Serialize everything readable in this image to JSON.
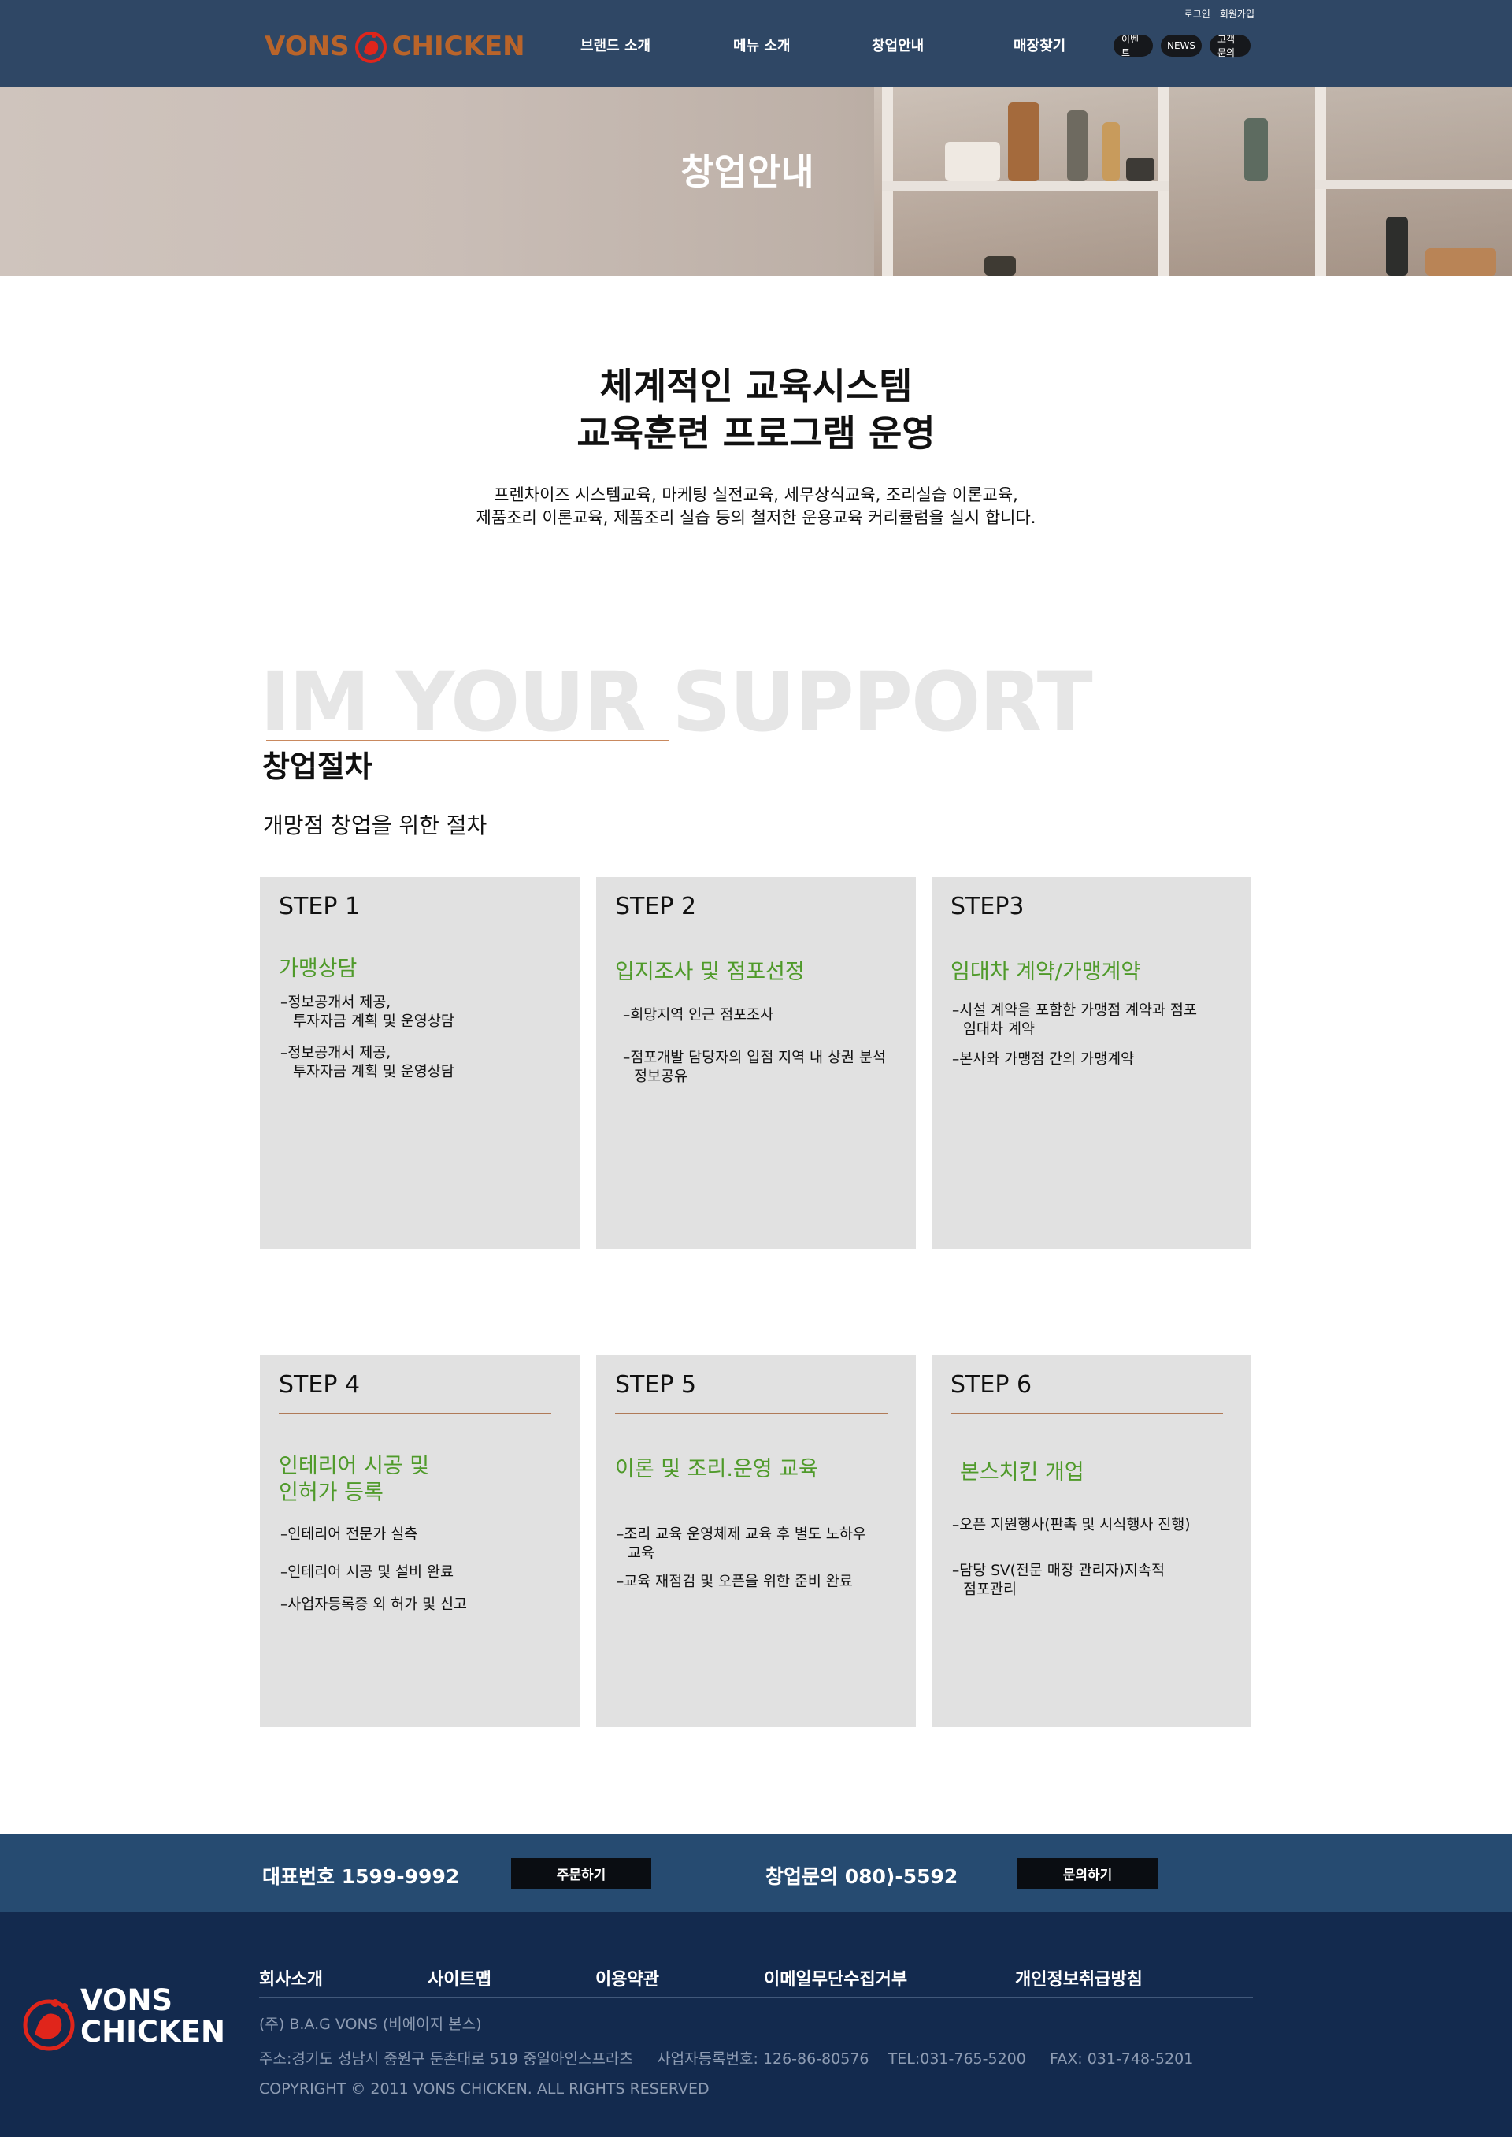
{
  "header": {
    "logo": {
      "left": "VONS",
      "right": "CHICKEN"
    },
    "nav": [
      "브랜드 소개",
      "메뉴 소개",
      "창업안내",
      "매장찾기"
    ],
    "util": {
      "login": "로그인",
      "signup": "회원가입"
    },
    "pills": [
      "이벤트",
      "NEWS",
      "고객문의"
    ]
  },
  "hero": {
    "title": "창업안내"
  },
  "intro": {
    "heading_line1": "체계적인 교육시스템",
    "heading_line2": "교육훈련 프로그램 운영",
    "desc_line1": "프렌차이즈 시스템교육, 마케팅 실전교육, 세무상식교육, 조리실습 이론교육,",
    "desc_line2": "제품조리 이론교육, 제품조리 실습 등의 철저한 운용교육 커리큘럼을 실시 합니다."
  },
  "support": {
    "bg_text": "IM YOUR SUPPORT",
    "title": "창업절차",
    "subtitle": "개망점 창업을  위한 절차"
  },
  "steps": [
    {
      "step": "STEP 1",
      "title": [
        "가맹상담"
      ],
      "items": [
        [
          "–정보공개서 제공,",
          "  투자자금 계획 및 운영상담"
        ],
        [
          "–정보공개서 제공,",
          "  투자자금 계획 및 운영상담"
        ]
      ]
    },
    {
      "step": "STEP 2",
      "title": [
        "입지조사 및 점포선정"
      ],
      "items": [
        [
          "–희망지역 인근 점포조사"
        ],
        [
          "–점포개발 담당자의 입점 지역 내 상권 분석",
          "  정보공유"
        ]
      ]
    },
    {
      "step": "STEP3",
      "title": [
        "임대차 계약/가맹계약"
      ],
      "items": [
        [
          "–시설 계약을 포함한 가맹점 계약과 점포",
          "  임대차 계약"
        ],
        [
          "–본사와 가맹점 간의 가맹계약"
        ]
      ]
    },
    {
      "step": "STEP 4",
      "title": [
        "인테리어 시공 및",
        "인허가 등록"
      ],
      "items": [
        [
          "–인테리어 전문가 실측"
        ],
        [
          "–인테리어 시공 및 설비 완료"
        ],
        [
          "–사업자등록증 외 허가 및 신고"
        ]
      ]
    },
    {
      "step": "STEP 5",
      "title": [
        "이론 및 조리.운영 교육"
      ],
      "items": [
        [
          "–조리 교육 운영체제 교육 후 별도 노하우",
          "  교육"
        ],
        [
          "–교육 재점검 및 오픈을 위한 준비 완료"
        ]
      ]
    },
    {
      "step": "STEP 6",
      "title": [
        "본스치킨 개업"
      ],
      "items": [
        [
          "–오픈 지원행사(판촉 및 시식행사 진행)"
        ],
        [
          "–담당 SV(전문 매장 관리자)지속적",
          "  점포관리"
        ]
      ]
    }
  ],
  "contact": {
    "phone_label": "대표번호 1599-9992",
    "order_button": "주문하기",
    "startup_label": "창업문의 080)-5592",
    "inquiry_button": "문의하기"
  },
  "footer": {
    "logo_line1": "VONS",
    "logo_line2": "CHICKEN",
    "nav": [
      "회사소개",
      "사이트맵",
      "이용약관",
      "이메일무단수집거부",
      "개인정보취급방침"
    ],
    "company": "(주) B.A.G VONS (비에이지 본스)",
    "address": "주소:경기도 성남시 중원구 둔촌대로 519 중일아인스프라츠     사업자등록번호: 126-86-80576    TEL:031-765-5200     FAX: 031-748-5201",
    "copyright": "COPYRIGHT © 2011 VONS CHICKEN. ALL RIGHTS RESERVED"
  },
  "colors": {
    "header_bg": "#2f4765",
    "accent_green": "#4f9a2a",
    "logo_brown": "#b9642a",
    "contact_bg": "#264b71",
    "footer_bg": "#132a4e",
    "card_bg": "#e1e1e1"
  }
}
